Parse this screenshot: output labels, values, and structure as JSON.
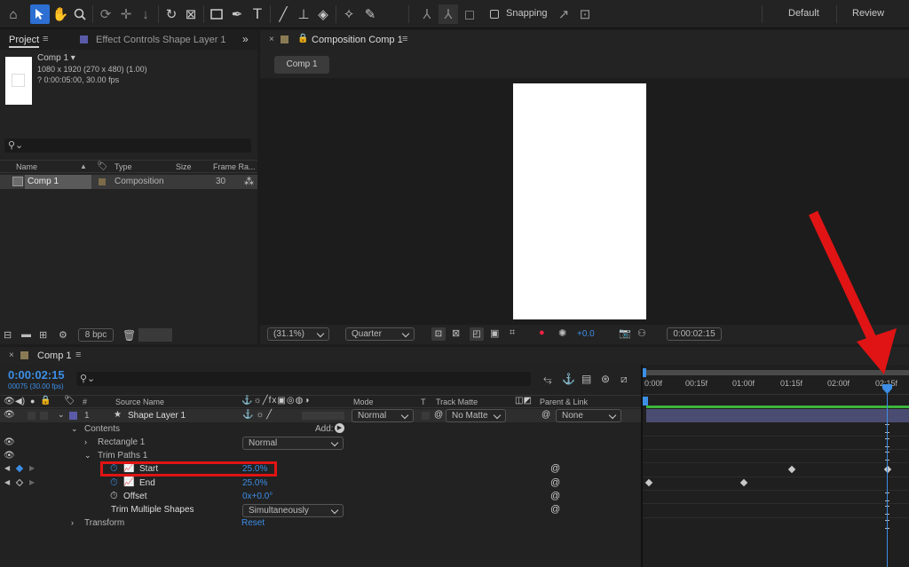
{
  "toolbar": {
    "snapping_label": "Snapping",
    "workspaces": [
      "Default",
      "Review"
    ]
  },
  "project_panel": {
    "tab_project": "Project",
    "tab_effect_controls": "Effect Controls Shape Layer 1",
    "comp_name": "Comp 1",
    "comp_info_line1": "1080 x 1920  (270 x 480) (1.00)",
    "comp_info_line2": "? 0:00:05:00, 30.00 fps",
    "columns": [
      "Name",
      "Type",
      "Size",
      "Frame Ra..."
    ],
    "items": [
      {
        "name": "Comp 1",
        "type": "Composition",
        "size": "",
        "frame_rate": "30"
      }
    ],
    "bpc": "8 bpc"
  },
  "composition_panel": {
    "tab_title": "Composition Comp 1",
    "comp_chip": "Comp 1",
    "zoom": "(31.1%)",
    "resolution": "Quarter",
    "exposure": "+0.0",
    "timecode": "0:00:02:15"
  },
  "timeline": {
    "tab_title": "Comp 1",
    "current_time": "0:00:02:15",
    "frame_info": "00075 (30.00 fps)",
    "headers": {
      "source_name": "Source Name",
      "hash": "#",
      "mode": "Mode",
      "t": "T",
      "track_matte": "Track Matte",
      "parent": "Parent & Link"
    },
    "layer": {
      "index": "1",
      "name": "Shape Layer 1",
      "mode": "Normal",
      "matte": "No Matte",
      "parent": "None"
    },
    "contents_label": "Contents",
    "add_label": "Add:",
    "rectangle_label": "Rectangle 1",
    "rectangle_mode": "Normal",
    "trim_paths_label": "Trim Paths 1",
    "start_label": "Start",
    "start_value": "25.0%",
    "end_label": "End",
    "end_value": "25.0%",
    "offset_label": "Offset",
    "offset_value": "0x+0.0°",
    "trim_multiple_label": "Trim Multiple Shapes",
    "trim_multiple_value": "Simultaneously",
    "transform_label": "Transform",
    "reset_label": "Reset",
    "ruler_labels": [
      "0:00f",
      "00:15f",
      "01:00f",
      "01:15f",
      "02:00f",
      "02:15f"
    ]
  },
  "colors": {
    "accent": "#2d6fd2",
    "time_blue": "#3c8ee6",
    "annotation_red": "#e01414",
    "layer_bar": "#4b4c72",
    "track_green": "#3db43d"
  }
}
